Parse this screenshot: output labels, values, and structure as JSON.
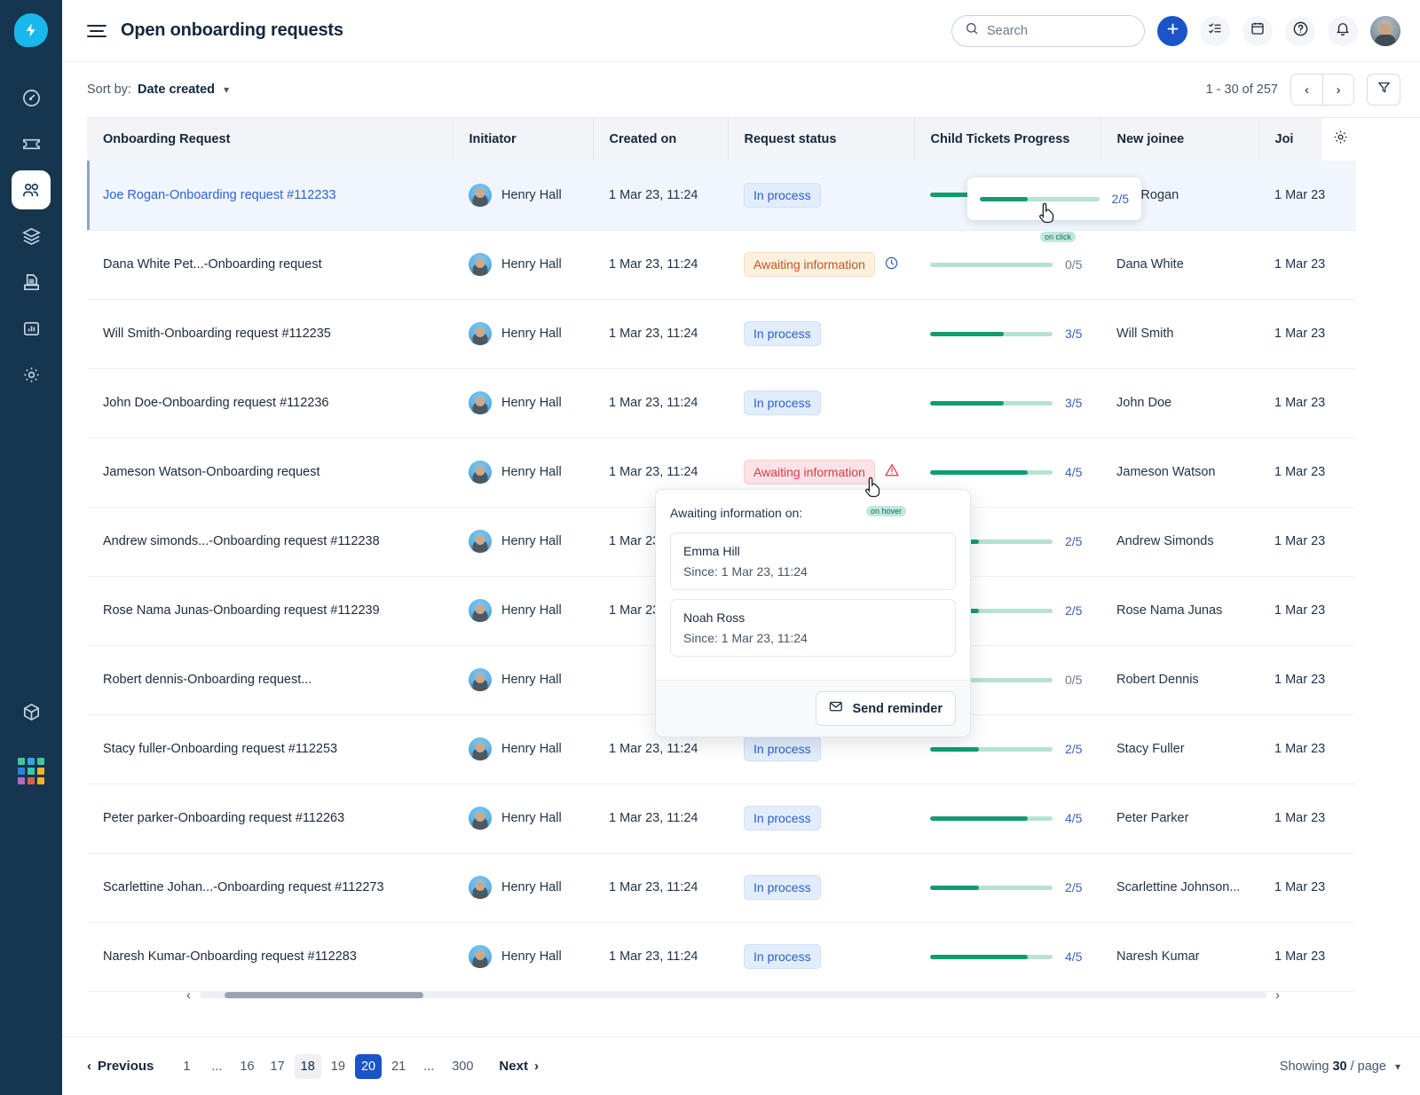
{
  "brand": {
    "logo_icon": "lightning-bolt-icon",
    "accent": "#18b8ec"
  },
  "sidebar": {
    "items": [
      {
        "label": "Dashboard",
        "icon": "gauge-icon",
        "active": false,
        "has_dots": false
      },
      {
        "label": "Tickets",
        "icon": "ticket-icon",
        "active": false,
        "has_dots": false
      },
      {
        "label": "Onboarding",
        "icon": "people-icon",
        "active": true,
        "has_dots": true
      },
      {
        "label": "Assets",
        "icon": "layers-icon",
        "active": false,
        "has_dots": true
      },
      {
        "label": "Knowledge base",
        "icon": "document-archive-icon",
        "active": false,
        "has_dots": false
      },
      {
        "label": "Analytics",
        "icon": "bar-chart-icon",
        "active": false,
        "has_dots": false
      },
      {
        "label": "Admin",
        "icon": "gear-icon",
        "active": false,
        "has_dots": false
      }
    ],
    "bottom": [
      {
        "label": "Apps",
        "icon": "cube-icon",
        "has_dots": true
      }
    ],
    "grid_colors": [
      "#3cc9a0",
      "#2fa8df",
      "#3cc9a0",
      "#2f7fdf",
      "#3cc9a0",
      "#f0b429",
      "#b06ac4",
      "#e05c4b",
      "#f0b429"
    ]
  },
  "topbar": {
    "menu_icon": "hamburger-menu-icon",
    "title": "Open onboarding requests",
    "search": {
      "placeholder": "Search",
      "value": "",
      "icon": "search-icon"
    },
    "actions": [
      {
        "name": "add-button",
        "icon": "plus-icon",
        "style": "primary"
      },
      {
        "name": "tasks-button",
        "icon": "checklist-icon",
        "style": "soft"
      },
      {
        "name": "calendar-button",
        "icon": "calendar-icon",
        "style": "soft"
      },
      {
        "name": "help-button",
        "icon": "question-circle-icon",
        "style": "soft"
      },
      {
        "name": "notifications-button",
        "icon": "bell-icon",
        "style": "soft"
      }
    ],
    "avatar": "user-avatar"
  },
  "toolbar": {
    "sort_label": "Sort by:",
    "sort_value": "Date created",
    "sort_chevron": "chevron-down-icon",
    "range": "1 - 30 of 257",
    "prev_icon": "chevron-left-icon",
    "next_icon": "chevron-right-icon",
    "filter_icon": "filter-funnel-icon",
    "settings_icon": "gear-icon"
  },
  "table": {
    "columns": [
      "Onboarding Request",
      "Initiator",
      "Created on",
      "Request status",
      "Child Tickets Progress",
      "New joinee",
      "Joi"
    ],
    "rows": [
      {
        "request": "Joe Rogan-Onboarding request #112233",
        "link": true,
        "initiator": "Henry Hall",
        "created": "1 Mar 23, 11:24",
        "status": "In process",
        "status_kind": "inprocess",
        "status_icon": "",
        "progress_done": 2,
        "progress_total": 5,
        "progress_label": "2/5",
        "joinee": "Joe Rogan",
        "joining": "1 Mar 23",
        "selected": true
      },
      {
        "request": "Dana White Pet...-Onboarding request",
        "link": false,
        "initiator": "Henry Hall",
        "created": "1 Mar 23, 11:24",
        "status": "Awaiting information",
        "status_kind": "awaiting-amber",
        "status_icon": "clock-icon",
        "progress_done": 0,
        "progress_total": 5,
        "progress_label": "0/5",
        "joinee": "Dana White",
        "joining": "1 Mar 23",
        "selected": false
      },
      {
        "request": "Will Smith-Onboarding request #112235",
        "link": false,
        "initiator": "Henry Hall",
        "created": "1 Mar 23, 11:24",
        "status": "In process",
        "status_kind": "inprocess",
        "status_icon": "",
        "progress_done": 3,
        "progress_total": 5,
        "progress_label": "3/5",
        "joinee": "Will Smith",
        "joining": "1 Mar 23",
        "selected": false
      },
      {
        "request": "John Doe-Onboarding request #112236",
        "link": false,
        "initiator": "Henry Hall",
        "created": "1 Mar 23, 11:24",
        "status": "In process",
        "status_kind": "inprocess",
        "status_icon": "",
        "progress_done": 3,
        "progress_total": 5,
        "progress_label": "3/5",
        "joinee": "John Doe",
        "joining": "1 Mar 23",
        "selected": false
      },
      {
        "request": "Jameson Watson-Onboarding request",
        "link": false,
        "initiator": "Henry Hall",
        "created": "1 Mar 23, 11:24",
        "status": "Awaiting information",
        "status_kind": "awaiting-red",
        "status_icon": "warning-triangle-icon",
        "progress_done": 4,
        "progress_total": 5,
        "progress_label": "4/5",
        "joinee": "Jameson Watson",
        "joining": "1 Mar 23",
        "selected": false
      },
      {
        "request": "Andrew simonds...-Onboarding request #112238",
        "link": false,
        "initiator": "Henry Hall",
        "created": "1 Mar 23, 11:24",
        "status": "",
        "status_kind": "",
        "status_icon": "",
        "progress_done": 2,
        "progress_total": 5,
        "progress_label": "2/5",
        "joinee": "Andrew Simonds",
        "joining": "1 Mar 23",
        "selected": false
      },
      {
        "request": "Rose Nama Junas-Onboarding request #112239",
        "link": false,
        "initiator": "Henry Hall",
        "created": "1 Mar 23, 11:24",
        "status": "",
        "status_kind": "",
        "status_icon": "",
        "progress_done": 2,
        "progress_total": 5,
        "progress_label": "2/5",
        "joinee": "Rose Nama Junas",
        "joining": "1 Mar 23",
        "selected": false
      },
      {
        "request": "Robert dennis-Onboarding request...",
        "link": false,
        "initiator": "Henry Hall",
        "created": "",
        "status": "",
        "status_kind": "",
        "status_icon": "",
        "progress_done": 0,
        "progress_total": 5,
        "progress_label": "0/5",
        "joinee": "Robert Dennis",
        "joining": "1 Mar 23",
        "selected": false
      },
      {
        "request": "Stacy fuller-Onboarding request #112253",
        "link": false,
        "initiator": "Henry Hall",
        "created": "1 Mar 23, 11:24",
        "status": "In process",
        "status_kind": "inprocess",
        "status_icon": "",
        "progress_done": 2,
        "progress_total": 5,
        "progress_label": "2/5",
        "joinee": "Stacy Fuller",
        "joining": "1 Mar 23",
        "selected": false
      },
      {
        "request": "Peter parker-Onboarding request #112263",
        "link": false,
        "initiator": "Henry Hall",
        "created": "1 Mar 23, 11:24",
        "status": "In process",
        "status_kind": "inprocess",
        "status_icon": "",
        "progress_done": 4,
        "progress_total": 5,
        "progress_label": "4/5",
        "joinee": "Peter Parker",
        "joining": "1 Mar 23",
        "selected": false
      },
      {
        "request": "Scarlettine Johan...-Onboarding request #112273",
        "link": false,
        "initiator": "Henry Hall",
        "created": "1 Mar 23, 11:24",
        "status": "In process",
        "status_kind": "inprocess",
        "status_icon": "",
        "progress_done": 2,
        "progress_total": 5,
        "progress_label": "2/5",
        "joinee": "Scarlettine Johnson...",
        "joining": "1 Mar 23",
        "selected": false
      },
      {
        "request": "Naresh Kumar-Onboarding request #112283",
        "link": false,
        "initiator": "Henry Hall",
        "created": "1 Mar 23, 11:24",
        "status": "In process",
        "status_kind": "inprocess",
        "status_icon": "",
        "progress_done": 4,
        "progress_total": 5,
        "progress_label": "4/5",
        "joinee": "Naresh Kumar",
        "joining": "1 Mar 23",
        "selected": false
      }
    ]
  },
  "annotations": {
    "on_click": "on click",
    "on_hover": "on hover"
  },
  "popover": {
    "title": "Awaiting information on:",
    "people": [
      {
        "name": "Emma Hill",
        "since": "Since: 1 Mar 23, 11:24"
      },
      {
        "name": "Noah Ross",
        "since": "Since: 1 Mar 23, 11:24"
      }
    ],
    "action_label": "Send reminder",
    "action_icon": "envelope-icon"
  },
  "pagination": {
    "previous": "Previous",
    "next": "Next",
    "pages": [
      {
        "label": "1",
        "state": "normal"
      },
      {
        "label": "...",
        "state": "dots"
      },
      {
        "label": "16",
        "state": "normal"
      },
      {
        "label": "17",
        "state": "normal"
      },
      {
        "label": "18",
        "state": "soft"
      },
      {
        "label": "19",
        "state": "normal"
      },
      {
        "label": "20",
        "state": "current"
      },
      {
        "label": "21",
        "state": "normal"
      },
      {
        "label": "...",
        "state": "dots"
      },
      {
        "label": "300",
        "state": "normal"
      }
    ],
    "showing_prefix": "Showing",
    "showing_value": "30",
    "showing_suffix": "/ page"
  }
}
